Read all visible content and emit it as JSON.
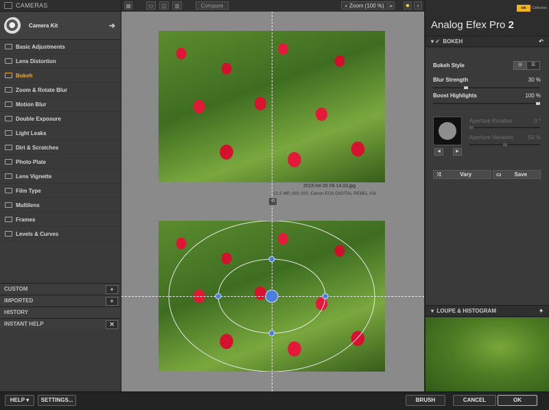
{
  "left_panel": {
    "header": "CAMERAS",
    "camera_kit": "Camera Kit",
    "filters": [
      {
        "label": "Basic Adjustments",
        "active": false
      },
      {
        "label": "Lens Distortion",
        "active": false
      },
      {
        "label": "Bokeh",
        "active": true
      },
      {
        "label": "Zoom & Rotate Blur",
        "active": false
      },
      {
        "label": "Motion Blur",
        "active": false
      },
      {
        "label": "Double Exposure",
        "active": false
      },
      {
        "label": "Light Leaks",
        "active": false
      },
      {
        "label": "Dirt & Scratches",
        "active": false
      },
      {
        "label": "Photo Plate",
        "active": false
      },
      {
        "label": "Lens Vignette",
        "active": false
      },
      {
        "label": "Film Type",
        "active": false
      },
      {
        "label": "Multilens",
        "active": false
      },
      {
        "label": "Frames",
        "active": false
      },
      {
        "label": "Levels & Curves",
        "active": false
      }
    ],
    "sections": {
      "custom": "CUSTOM",
      "imported": "IMPORTED",
      "history": "HISTORY",
      "instant_help": "INSTANT HELP"
    },
    "accent_color": "#f3a92b"
  },
  "toolbar": {
    "compare": "Compare",
    "zoom": "Zoom (100 %)"
  },
  "canvas": {
    "filename": "2015-04-25 09.14.03.jpg",
    "meta": "12.2 MP, ISO 200, Canon EOS DIGITAL REBEL XSi"
  },
  "right_panel": {
    "brand_badge": "nik",
    "brand_collection": "Collection",
    "app_title": "Analog Efex Pro",
    "app_version": "2",
    "section_title": "BOKEH",
    "bokeh_style_label": "Bokeh Style",
    "blur_strength_label": "Blur Strength",
    "blur_strength_value": "30 %",
    "blur_strength_level": 0.3,
    "boost_highlights_label": "Boost Highlights",
    "boost_highlights_value": "100 %",
    "boost_highlights_level": 1.0,
    "aperture_rotation_label": "Aperture Rotation",
    "aperture_rotation_value": "0 °",
    "aperture_variation_label": "Aperture Variation",
    "aperture_variation_value": "50 %",
    "vary_label": "Vary",
    "save_label": "Save",
    "loupe_title": "LOUPE & HISTOGRAM"
  },
  "bottom_bar": {
    "help": "HELP",
    "settings": "SETTINGS...",
    "brush": "BRUSH",
    "cancel": "CANCEL",
    "ok": "OK"
  }
}
